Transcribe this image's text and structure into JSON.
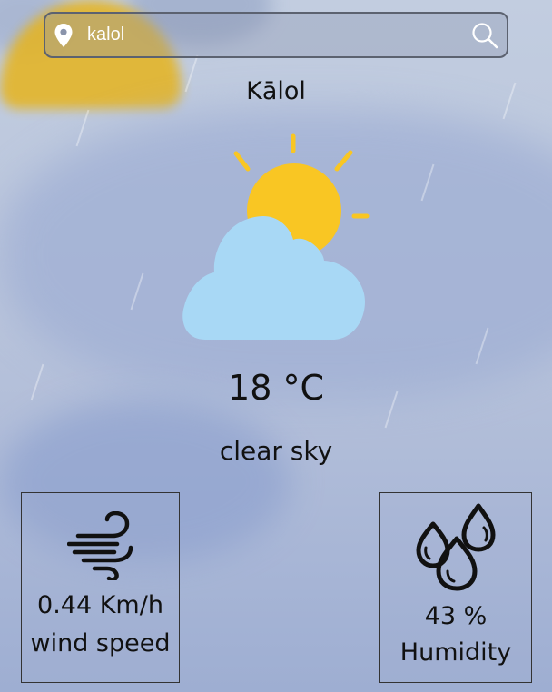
{
  "search": {
    "value": "kalol",
    "placeholder": ""
  },
  "location": {
    "city": "Kālol"
  },
  "current": {
    "temperature": "18 °C",
    "description": "clear sky",
    "icon": "partly-cloudy-icon"
  },
  "wind": {
    "value": "0.44 Km/h",
    "label": "wind speed",
    "icon": "wind-icon"
  },
  "humidity": {
    "value": "43 %",
    "label": "Humidity",
    "icon": "humidity-drops-icon"
  },
  "icons": {
    "location": "map-pin-icon",
    "search": "search-icon"
  },
  "colors": {
    "sun": "#F9C623",
    "cloud": "#A8D8F5",
    "text": "#111111",
    "input_text": "#FFFFFF"
  }
}
